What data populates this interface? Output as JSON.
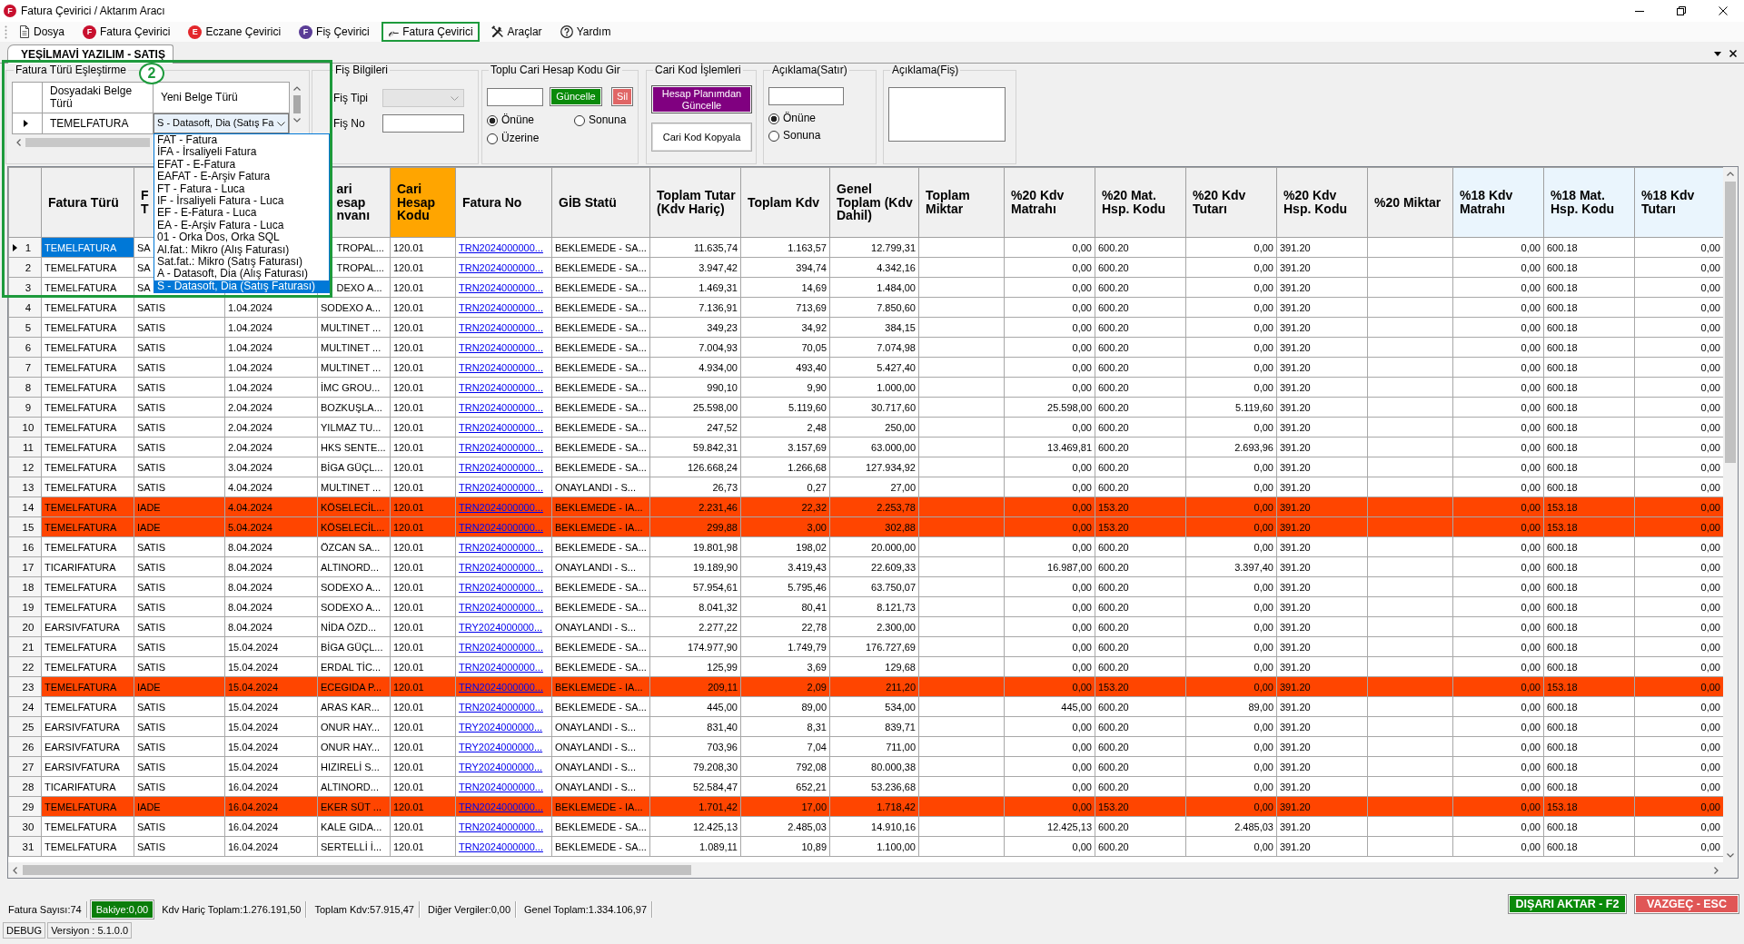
{
  "window": {
    "title": "Fatura Çevirici / Aktarım Aracı",
    "icon_letter": "F"
  },
  "menu": [
    {
      "label": "Dosya",
      "kind": "document",
      "highlighted": false
    },
    {
      "label": "Fatura Çevirici",
      "kind": "letter",
      "letter": "F",
      "color": "#c8102e",
      "highlighted": false
    },
    {
      "label": "Eczane Çevirici",
      "kind": "letter",
      "letter": "E",
      "color": "#e3262b",
      "highlighted": false
    },
    {
      "label": "Fiş Çevirici",
      "kind": "letter",
      "letter": "F",
      "color": "#5a3c96",
      "highlighted": false
    },
    {
      "label": "Fatura Çevirici",
      "kind": "glyph",
      "glyph": "ℯ–",
      "highlighted": true
    },
    {
      "label": "Araçlar",
      "kind": "tools",
      "highlighted": false
    },
    {
      "label": "Yardım",
      "kind": "help",
      "highlighted": false
    }
  ],
  "tabs": [
    {
      "label": "YEŞİLMAVİ YAZILIM - SATIŞ",
      "selected": true
    }
  ],
  "annotation": {
    "label": "2"
  },
  "type_mapping": {
    "title": "Fatura Türü Eşleştirme",
    "columns": [
      "Dosyadaki Belge Türü",
      "Yeni Belge Türü"
    ],
    "rows": [
      {
        "source": "TEMELFATURA",
        "target": "S - Datasoft, Dia (Satış Fa",
        "selected": true
      }
    ],
    "dropdown": {
      "expanded": true,
      "options": [
        {
          "label": "FAT - Fatura",
          "selected": false
        },
        {
          "label": "İFA - İrsaliyeli Fatura",
          "selected": false
        },
        {
          "label": "EFAT - E-Fatura",
          "selected": false
        },
        {
          "label": "EAFAT - E-Arşiv Fatura",
          "selected": false
        },
        {
          "label": "FT - Fatura - Luca",
          "selected": false
        },
        {
          "label": "IF - İrsaliyeli Fatura - Luca",
          "selected": false
        },
        {
          "label": "EF - E-Fatura - Luca",
          "selected": false
        },
        {
          "label": "EA - E-Arşiv Fatura - Luca",
          "selected": false
        },
        {
          "label": "01 - Orka Dos, Orka SQL",
          "selected": false
        },
        {
          "label": "Al.fat.: Mikro (Alış Faturası)",
          "selected": false
        },
        {
          "label": "Sat.fat.: Mikro (Satış Faturası)",
          "selected": false
        },
        {
          "label": "A - Datasoft, Dia (Alış Faturası)",
          "selected": false
        },
        {
          "label": "S - Datasoft, Dia (Satış Faturası)",
          "selected": true
        }
      ]
    }
  },
  "receipt_info": {
    "title": "Fiş Bilgileri",
    "fields": [
      {
        "label": "Fiş Tipi",
        "kind": "select",
        "disabled": true
      },
      {
        "label": "Fiş No",
        "kind": "text",
        "disabled": false
      }
    ]
  },
  "bulk_account_code": {
    "title": "Toplu Cari Hesap Kodu Gir",
    "buttons": [
      {
        "label": "Güncelle",
        "kind": "success"
      },
      {
        "label": "Sil",
        "kind": "danger"
      }
    ],
    "options": [
      {
        "label": "Önüne",
        "selected": true
      },
      {
        "label": "Sonuna",
        "selected": false
      },
      {
        "label": "Üzerine",
        "selected": false
      }
    ]
  },
  "account_code_actions": {
    "title": "Cari Kod İşlemleri",
    "buttons": [
      {
        "label": "Hesap Planımdan Güncelle",
        "kind": "purple"
      },
      {
        "label": "Cari Kod Kopyala",
        "kind": "plain"
      }
    ]
  },
  "line_description": {
    "title": "Açıklama(Satır)",
    "options": [
      {
        "label": "Önüne",
        "selected": true
      },
      {
        "label": "Sonuna",
        "selected": false
      }
    ]
  },
  "receipt_description": {
    "title": "Açıklama(Fiş)"
  },
  "grid": {
    "columns": [
      {
        "label": "Fatura Türü",
        "kind": "text"
      },
      {
        "label": "F\nT",
        "kind": "text"
      },
      {
        "kind": "text"
      },
      {
        "label": "ari\nesap\nnvanı",
        "kind": "text"
      },
      {
        "label": "Cari Hesap Kodu",
        "kind": "text",
        "color": "#ffa500"
      },
      {
        "label": "Fatura No",
        "kind": "link"
      },
      {
        "label": "GİB Statü",
        "kind": "text"
      },
      {
        "label": "Toplam Tutar (Kdv Hariç)",
        "kind": "number"
      },
      {
        "label": "Toplam Kdv",
        "kind": "number"
      },
      {
        "label": "Genel Toplam (Kdv Dahil)",
        "kind": "number"
      },
      {
        "label": "Toplam Miktar",
        "kind": "number"
      },
      {
        "label": "%20 Kdv Matrahı",
        "kind": "number"
      },
      {
        "label": "%20 Mat. Hsp. Kodu",
        "kind": "text"
      },
      {
        "label": "%20 Kdv Tutarı",
        "kind": "number"
      },
      {
        "label": "%20 Kdv Hsp. Kodu",
        "kind": "text"
      },
      {
        "label": "%20 Miktar",
        "kind": "number"
      },
      {
        "label": "%18 Kdv Matrahı",
        "kind": "number",
        "color": "#eaf5fd"
      },
      {
        "label": "%18 Mat. Hsp. Kodu",
        "kind": "text",
        "color": "#eaf5fd"
      },
      {
        "label": "%18 Kdv Tutarı",
        "kind": "number",
        "color": "#eaf5fd"
      }
    ],
    "rows": [
      {
        "number": "1",
        "selected": true,
        "highlighted": false,
        "cells": [
          "TEMELFATURA",
          "SA",
          null,
          "TROPAL...",
          "120.01",
          "TRN2024000000...",
          "BEKLEMEDE - SA...",
          "11.635,74",
          "1.163,57",
          "12.799,31",
          null,
          "0,00",
          "600.20",
          "0,00",
          "391.20",
          null,
          "0,00",
          "600.18",
          "0,00"
        ]
      },
      {
        "number": "2",
        "selected": false,
        "highlighted": false,
        "cells": [
          "TEMELFATURA",
          "SA",
          null,
          "TROPAL...",
          "120.01",
          "TRN2024000000...",
          "BEKLEMEDE - SA...",
          "3.947,42",
          "394,74",
          "4.342,16",
          null,
          "0,00",
          "600.20",
          "0,00",
          "391.20",
          null,
          "0,00",
          "600.18",
          "0,00"
        ]
      },
      {
        "number": "3",
        "selected": false,
        "highlighted": false,
        "cells": [
          "TEMELFATURA",
          "SA",
          null,
          "DEXO A...",
          "120.01",
          "TRN2024000000...",
          "BEKLEMEDE - SA...",
          "1.469,31",
          "14,69",
          "1.484,00",
          null,
          "0,00",
          "600.20",
          "0,00",
          "391.20",
          null,
          "0,00",
          "600.18",
          "0,00"
        ]
      },
      {
        "number": "4",
        "selected": false,
        "highlighted": false,
        "cells": [
          "TEMELFATURA",
          "SATIS",
          "1.04.2024",
          "SODEXO A...",
          "120.01",
          "TRN2024000000...",
          "BEKLEMEDE - SA...",
          "7.136,91",
          "713,69",
          "7.850,60",
          null,
          "0,00",
          "600.20",
          "0,00",
          "391.20",
          null,
          "0,00",
          "600.18",
          "0,00"
        ]
      },
      {
        "number": "5",
        "selected": false,
        "highlighted": false,
        "cells": [
          "TEMELFATURA",
          "SATIS",
          "1.04.2024",
          "MULTINET ...",
          "120.01",
          "TRN2024000000...",
          "BEKLEMEDE - SA...",
          "349,23",
          "34,92",
          "384,15",
          null,
          "0,00",
          "600.20",
          "0,00",
          "391.20",
          null,
          "0,00",
          "600.18",
          "0,00"
        ]
      },
      {
        "number": "6",
        "selected": false,
        "highlighted": false,
        "cells": [
          "TEMELFATURA",
          "SATIS",
          "1.04.2024",
          "MULTINET ...",
          "120.01",
          "TRN2024000000...",
          "BEKLEMEDE - SA...",
          "7.004,93",
          "70,05",
          "7.074,98",
          null,
          "0,00",
          "600.20",
          "0,00",
          "391.20",
          null,
          "0,00",
          "600.18",
          "0,00"
        ]
      },
      {
        "number": "7",
        "selected": false,
        "highlighted": false,
        "cells": [
          "TEMELFATURA",
          "SATIS",
          "1.04.2024",
          "MULTINET ...",
          "120.01",
          "TRN2024000000...",
          "BEKLEMEDE - SA...",
          "4.934,00",
          "493,40",
          "5.427,40",
          null,
          "0,00",
          "600.20",
          "0,00",
          "391.20",
          null,
          "0,00",
          "600.18",
          "0,00"
        ]
      },
      {
        "number": "8",
        "selected": false,
        "highlighted": false,
        "cells": [
          "TEMELFATURA",
          "SATIS",
          "1.04.2024",
          "İMC GROU...",
          "120.01",
          "TRN2024000000...",
          "BEKLEMEDE - SA...",
          "990,10",
          "9,90",
          "1.000,00",
          null,
          "0,00",
          "600.20",
          "0,00",
          "391.20",
          null,
          "0,00",
          "600.18",
          "0,00"
        ]
      },
      {
        "number": "9",
        "selected": false,
        "highlighted": false,
        "cells": [
          "TEMELFATURA",
          "SATIS",
          "2.04.2024",
          "BOZKUŞLA...",
          "120.01",
          "TRN2024000000...",
          "BEKLEMEDE - SA...",
          "25.598,00",
          "5.119,60",
          "30.717,60",
          null,
          "25.598,00",
          "600.20",
          "5.119,60",
          "391.20",
          null,
          "0,00",
          "600.18",
          "0,00"
        ]
      },
      {
        "number": "10",
        "selected": false,
        "highlighted": false,
        "cells": [
          "TEMELFATURA",
          "SATIS",
          "2.04.2024",
          "YILMAZ TU...",
          "120.01",
          "TRN2024000000...",
          "BEKLEMEDE - SA...",
          "247,52",
          "2,48",
          "250,00",
          null,
          "0,00",
          "600.20",
          "0,00",
          "391.20",
          null,
          "0,00",
          "600.18",
          "0,00"
        ]
      },
      {
        "number": "11",
        "selected": false,
        "highlighted": false,
        "cells": [
          "TEMELFATURA",
          "SATIS",
          "2.04.2024",
          "HKS SENTE...",
          "120.01",
          "TRN2024000000...",
          "BEKLEMEDE - SA...",
          "59.842,31",
          "3.157,69",
          "63.000,00",
          null,
          "13.469,81",
          "600.20",
          "2.693,96",
          "391.20",
          null,
          "0,00",
          "600.18",
          "0,00"
        ]
      },
      {
        "number": "12",
        "selected": false,
        "highlighted": false,
        "cells": [
          "TEMELFATURA",
          "SATIS",
          "3.04.2024",
          "BİGA GÜÇL...",
          "120.01",
          "TRN2024000000...",
          "BEKLEMEDE - SA...",
          "126.668,24",
          "1.266,68",
          "127.934,92",
          null,
          "0,00",
          "600.20",
          "0,00",
          "391.20",
          null,
          "0,00",
          "600.18",
          "0,00"
        ]
      },
      {
        "number": "13",
        "selected": false,
        "highlighted": false,
        "cells": [
          "TEMELFATURA",
          "SATIS",
          "4.04.2024",
          "MULTINET ...",
          "120.01",
          "TRN2024000000...",
          "ONAYLANDI - S...",
          "26,73",
          "0,27",
          "27,00",
          null,
          "0,00",
          "600.20",
          "0,00",
          "391.20",
          null,
          "0,00",
          "600.18",
          "0,00"
        ]
      },
      {
        "number": "14",
        "selected": false,
        "highlighted": true,
        "cells": [
          "TEMELFATURA",
          "IADE",
          "4.04.2024",
          "KÖSELECİL...",
          "120.01",
          "TRN2024000000...",
          "BEKLEMEDE - IA...",
          "2.231,46",
          "22,32",
          "2.253,78",
          null,
          "0,00",
          "153.20",
          "0,00",
          "391.20",
          null,
          "0,00",
          "153.18",
          "0,00"
        ]
      },
      {
        "number": "15",
        "selected": false,
        "highlighted": true,
        "cells": [
          "TEMELFATURA",
          "IADE",
          "5.04.2024",
          "KÖSELECİL...",
          "120.01",
          "TRN2024000000...",
          "BEKLEMEDE - IA...",
          "299,88",
          "3,00",
          "302,88",
          null,
          "0,00",
          "153.20",
          "0,00",
          "391.20",
          null,
          "0,00",
          "153.18",
          "0,00"
        ]
      },
      {
        "number": "16",
        "selected": false,
        "highlighted": false,
        "cells": [
          "TEMELFATURA",
          "SATIS",
          "8.04.2024",
          "ÖZCAN SA...",
          "120.01",
          "TRN2024000000...",
          "BEKLEMEDE - SA...",
          "19.801,98",
          "198,02",
          "20.000,00",
          null,
          "0,00",
          "600.20",
          "0,00",
          "391.20",
          null,
          "0,00",
          "600.18",
          "0,00"
        ]
      },
      {
        "number": "17",
        "selected": false,
        "highlighted": false,
        "cells": [
          "TICARIFATURA",
          "SATIS",
          "8.04.2024",
          "ALTINORD...",
          "120.01",
          "TRN2024000000...",
          "ONAYLANDI - S...",
          "19.189,90",
          "3.419,43",
          "22.609,33",
          null,
          "16.987,00",
          "600.20",
          "3.397,40",
          "391.20",
          null,
          "0,00",
          "600.18",
          "0,00"
        ]
      },
      {
        "number": "18",
        "selected": false,
        "highlighted": false,
        "cells": [
          "TEMELFATURA",
          "SATIS",
          "8.04.2024",
          "SODEXO A...",
          "120.01",
          "TRN2024000000...",
          "BEKLEMEDE - SA...",
          "57.954,61",
          "5.795,46",
          "63.750,07",
          null,
          "0,00",
          "600.20",
          "0,00",
          "391.20",
          null,
          "0,00",
          "600.18",
          "0,00"
        ]
      },
      {
        "number": "19",
        "selected": false,
        "highlighted": false,
        "cells": [
          "TEMELFATURA",
          "SATIS",
          "8.04.2024",
          "SODEXO A...",
          "120.01",
          "TRN2024000000...",
          "BEKLEMEDE - SA...",
          "8.041,32",
          "80,41",
          "8.121,73",
          null,
          "0,00",
          "600.20",
          "0,00",
          "391.20",
          null,
          "0,00",
          "600.18",
          "0,00"
        ]
      },
      {
        "number": "20",
        "selected": false,
        "highlighted": false,
        "cells": [
          "EARSIVFATURA",
          "SATIS",
          "8.04.2024",
          "NİDA ÖZD...",
          "120.01",
          "TRY2024000000...",
          "ONAYLANDI - S...",
          "2.277,22",
          "22,78",
          "2.300,00",
          null,
          "0,00",
          "600.20",
          "0,00",
          "391.20",
          null,
          "0,00",
          "600.18",
          "0,00"
        ]
      },
      {
        "number": "21",
        "selected": false,
        "highlighted": false,
        "cells": [
          "TEMELFATURA",
          "SATIS",
          "15.04.2024",
          "BİGA GÜÇL...",
          "120.01",
          "TRN2024000000...",
          "BEKLEMEDE - SA...",
          "174.977,90",
          "1.749,79",
          "176.727,69",
          null,
          "0,00",
          "600.20",
          "0,00",
          "391.20",
          null,
          "0,00",
          "600.18",
          "0,00"
        ]
      },
      {
        "number": "22",
        "selected": false,
        "highlighted": false,
        "cells": [
          "TEMELFATURA",
          "SATIS",
          "15.04.2024",
          "ERDAL TİC...",
          "120.01",
          "TRN2024000000...",
          "BEKLEMEDE - SA...",
          "125,99",
          "3,69",
          "129,68",
          null,
          "0,00",
          "600.20",
          "0,00",
          "391.20",
          null,
          "0,00",
          "600.18",
          "0,00"
        ]
      },
      {
        "number": "23",
        "selected": false,
        "highlighted": true,
        "cells": [
          "TEMELFATURA",
          "IADE",
          "15.04.2024",
          "ECEGIDA P...",
          "120.01",
          "TRN2024000000...",
          "BEKLEMEDE - IA...",
          "209,11",
          "2,09",
          "211,20",
          null,
          "0,00",
          "153.20",
          "0,00",
          "391.20",
          null,
          "0,00",
          "153.18",
          "0,00"
        ]
      },
      {
        "number": "24",
        "selected": false,
        "highlighted": false,
        "cells": [
          "TEMELFATURA",
          "SATIS",
          "15.04.2024",
          "ARAS KAR...",
          "120.01",
          "TRN2024000000...",
          "BEKLEMEDE - SA...",
          "445,00",
          "89,00",
          "534,00",
          null,
          "445,00",
          "600.20",
          "89,00",
          "391.20",
          null,
          "0,00",
          "600.18",
          "0,00"
        ]
      },
      {
        "number": "25",
        "selected": false,
        "highlighted": false,
        "cells": [
          "EARSIVFATURA",
          "SATIS",
          "15.04.2024",
          "ONUR HAY...",
          "120.01",
          "TRY2024000000...",
          "ONAYLANDI - S...",
          "831,40",
          "8,31",
          "839,71",
          null,
          "0,00",
          "600.20",
          "0,00",
          "391.20",
          null,
          "0,00",
          "600.18",
          "0,00"
        ]
      },
      {
        "number": "26",
        "selected": false,
        "highlighted": false,
        "cells": [
          "EARSIVFATURA",
          "SATIS",
          "15.04.2024",
          "ONUR HAY...",
          "120.01",
          "TRY2024000000...",
          "ONAYLANDI - S...",
          "703,96",
          "7,04",
          "711,00",
          null,
          "0,00",
          "600.20",
          "0,00",
          "391.20",
          null,
          "0,00",
          "600.18",
          "0,00"
        ]
      },
      {
        "number": "27",
        "selected": false,
        "highlighted": false,
        "cells": [
          "EARSIVFATURA",
          "SATIS",
          "15.04.2024",
          "HIZIRELİ S...",
          "120.01",
          "TRY2024000000...",
          "ONAYLANDI - S...",
          "79.208,30",
          "792,08",
          "80.000,38",
          null,
          "0,00",
          "600.20",
          "0,00",
          "391.20",
          null,
          "0,00",
          "600.18",
          "0,00"
        ]
      },
      {
        "number": "28",
        "selected": false,
        "highlighted": false,
        "cells": [
          "TICARIFATURA",
          "SATIS",
          "16.04.2024",
          "ALTINORD...",
          "120.01",
          "TRN2024000000...",
          "ONAYLANDI - S...",
          "52.584,47",
          "652,21",
          "53.236,68",
          null,
          "0,00",
          "600.20",
          "0,00",
          "391.20",
          null,
          "0,00",
          "600.18",
          "0,00"
        ]
      },
      {
        "number": "29",
        "selected": false,
        "highlighted": true,
        "cells": [
          "TEMELFATURA",
          "IADE",
          "16.04.2024",
          "EKER SÜT ...",
          "120.01",
          "TRN2024000000...",
          "BEKLEMEDE - IA...",
          "1.701,42",
          "17,00",
          "1.718,42",
          null,
          "0,00",
          "153.20",
          "0,00",
          "391.20",
          null,
          "0,00",
          "153.18",
          "0,00"
        ]
      },
      {
        "number": "30",
        "selected": false,
        "highlighted": false,
        "cells": [
          "TEMELFATURA",
          "SATIS",
          "16.04.2024",
          "KALE GIDA...",
          "120.01",
          "TRN2024000000...",
          "BEKLEMEDE - SA...",
          "12.425,13",
          "2.485,03",
          "14.910,16",
          null,
          "12.425,13",
          "600.20",
          "2.485,03",
          "391.20",
          null,
          "0,00",
          "600.18",
          "0,00"
        ]
      },
      {
        "number": "31",
        "selected": false,
        "highlighted": false,
        "cells": [
          "TEMELFATURA",
          "SATIS",
          "16.04.2024",
          "SERTELLİ İ...",
          "120.01",
          "TRN2024000000...",
          "BEKLEMEDE - SA...",
          "1.089,11",
          "10,89",
          "1.100,00",
          null,
          "0,00",
          "600.20",
          "0,00",
          "391.20",
          null,
          "0,00",
          "600.18",
          "0,00"
        ]
      }
    ]
  },
  "summary": {
    "items": [
      {
        "text": "Fatura Sayısı:74",
        "highlighted": false
      },
      {
        "text": "Bakiye:0,00",
        "highlighted": true
      },
      {
        "text": "Kdv Hariç Toplam:1.276.191,50",
        "highlighted": false
      },
      {
        "text": "Toplam Kdv:57.915,47",
        "highlighted": false
      },
      {
        "text": "Diğer Vergiler:0,00",
        "highlighted": false
      },
      {
        "text": "Genel Toplam:1.334.106,97",
        "highlighted": false
      }
    ],
    "buttons": [
      {
        "label": "DIŞARI AKTAR - F2",
        "kind": "success"
      },
      {
        "label": "VAZGEÇ - ESC",
        "kind": "danger"
      }
    ]
  },
  "footer": [
    "DEBUG",
    "Versiyon : 5.1.0.0"
  ]
}
